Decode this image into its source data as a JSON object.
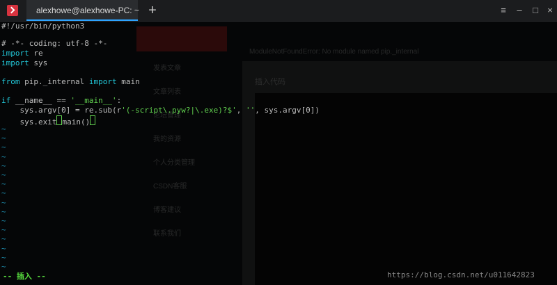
{
  "window": {
    "tab_title": "alexhowe@alexhowe-PC: ~",
    "add_tab_label": "+",
    "menu_label": "≡",
    "minimize_label": "–",
    "maximize_label": "□",
    "close_label": "×"
  },
  "editor": {
    "lines": [
      "#!/usr/bin/python3",
      "",
      "# -*- coding: utf-8 -*-",
      "import re",
      "import sys",
      "",
      "from pip._internal import main",
      "",
      "if __name__ == '__main__':",
      "    sys.argv[0] = re.sub(r'(-script\\.pyw?|\\.exe)?$', '', sys.argv[0])",
      "    sys.exit(main())"
    ],
    "tilde_count": 16,
    "mode": "-- 插入 --",
    "watermark": "https://blog.csdn.net/u011642823"
  },
  "ghost": {
    "left_items": [
      "发表文章",
      "文章列表",
      "论坛管理",
      "我的资源",
      "个人分类管理",
      "CSDN客服",
      "博客建议",
      "联系我们"
    ],
    "header": "ModuleNotFoundError: No module named pip._internal",
    "dialog_title": "插入代码"
  },
  "colors": {
    "tab_accent": "#2ea4ff",
    "cursor": "#61d04f",
    "keyword": "#22c7d8"
  }
}
